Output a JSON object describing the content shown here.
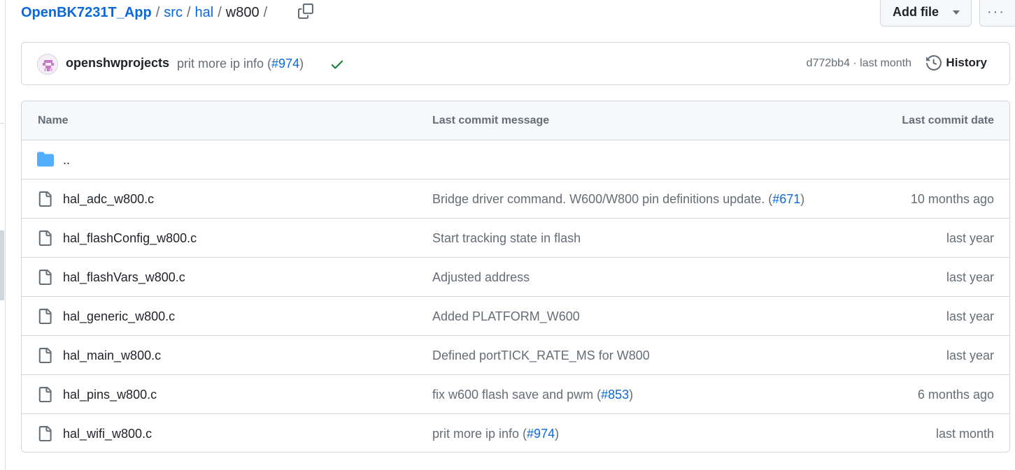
{
  "breadcrumb": {
    "repo": "OpenBK7231T_App",
    "path": [
      "src",
      "hal"
    ],
    "current": "w800",
    "separator": "/"
  },
  "toolbar": {
    "add_file_label": "Add file",
    "more_label": "···",
    "copy_icon": "copy-icon"
  },
  "latest_commit": {
    "author": "openshwprojects",
    "message": "prit more ip info (",
    "pr_link": "#974",
    "message_suffix": ")",
    "status": "success",
    "sha": "d772bb4",
    "time": "last month",
    "sha_time": "d772bb4 · last month",
    "history_label": "History"
  },
  "table": {
    "headers": {
      "name": "Name",
      "message": "Last commit message",
      "date": "Last commit date"
    },
    "parent_dir": "..",
    "rows": [
      {
        "name": "hal_adc_w800.c",
        "message": "Bridge driver command. W600/W800 pin definitions update. (",
        "link": "#671",
        "suffix": ")",
        "date": "10 months ago"
      },
      {
        "name": "hal_flashConfig_w800.c",
        "message": "Start tracking state in flash",
        "link": "",
        "suffix": "",
        "date": "last year"
      },
      {
        "name": "hal_flashVars_w800.c",
        "message": "Adjusted address",
        "link": "",
        "suffix": "",
        "date": "last year"
      },
      {
        "name": "hal_generic_w800.c",
        "message": "Added PLATFORM_W600",
        "link": "",
        "suffix": "",
        "date": "last year"
      },
      {
        "name": "hal_main_w800.c",
        "message": "Defined portTICK_RATE_MS for W800",
        "link": "",
        "suffix": "",
        "date": "last year"
      },
      {
        "name": "hal_pins_w800.c",
        "message": "fix w600 flash save and pwm (",
        "link": "#853",
        "suffix": ")",
        "date": "6 months ago"
      },
      {
        "name": "hal_wifi_w800.c",
        "message": "prit more ip info (",
        "link": "#974",
        "suffix": ")",
        "date": "last month"
      }
    ]
  },
  "colors": {
    "link": "#0969da",
    "muted": "#656d76",
    "border": "#d0d7de",
    "folder": "#54aeff",
    "success": "#1a7f37"
  }
}
